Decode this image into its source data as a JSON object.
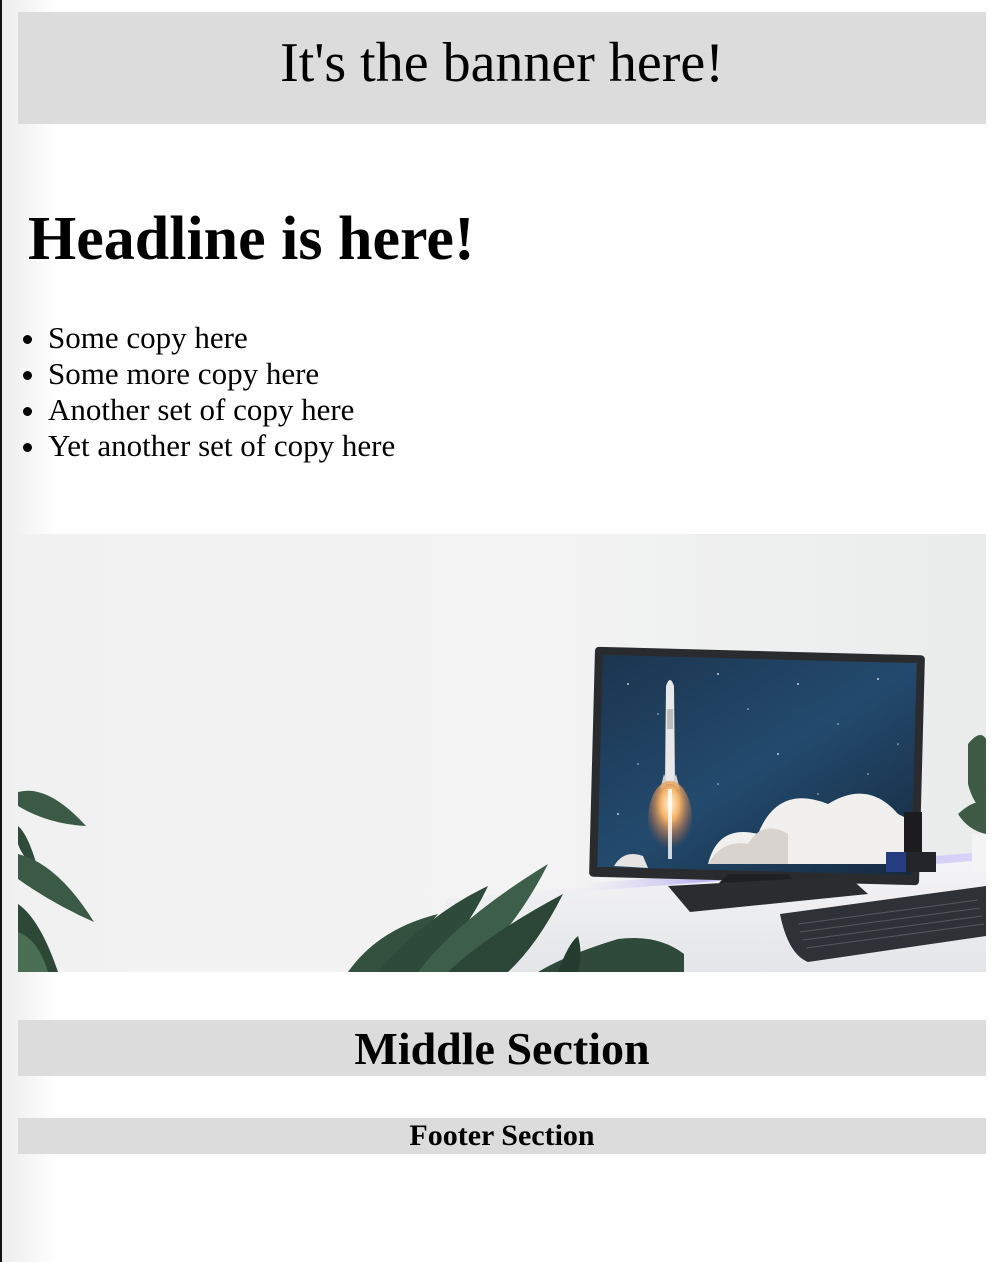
{
  "banner": {
    "text": "It's the banner here!"
  },
  "headline": {
    "text": "Headline is here!"
  },
  "copy_list": {
    "items": [
      "Some copy here",
      "Some more copy here",
      "Another set of copy here",
      "Yet another set of copy here"
    ]
  },
  "hero_image": {
    "subject": "desk-with-monitor-showing-rocket-launch-keyboard-and-plants"
  },
  "middle": {
    "title": "Middle Section"
  },
  "footer": {
    "title": "Footer Section"
  },
  "colors": {
    "section_bg": "#dcdcdc",
    "page_bg": "#ffffff",
    "text": "#000000"
  }
}
